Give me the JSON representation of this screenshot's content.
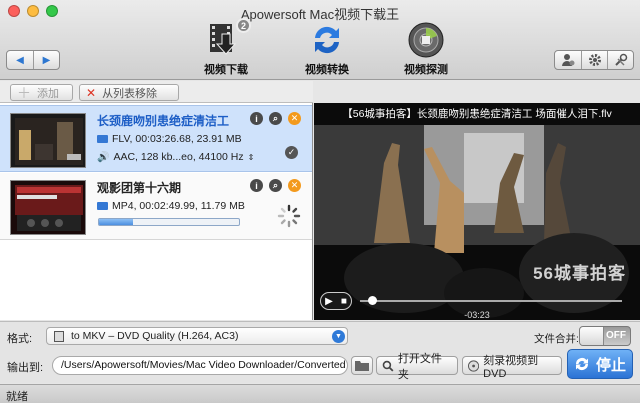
{
  "window": {
    "title": "Apowersoft Mac视频下载王"
  },
  "toolbar": {
    "back": "◀",
    "forward": "▶",
    "tools": [
      {
        "label": "视频下载",
        "badge": "2"
      },
      {
        "label": "视频转换"
      },
      {
        "label": "视频探测"
      }
    ]
  },
  "subbar": {
    "add_label": "添加",
    "remove_label": "从列表移除"
  },
  "items": [
    {
      "title": "长颈鹿吻别患绝症清洁工",
      "format_line": "FLV, 00:03:26.68, 23.91 MB",
      "audio_line": "AAC, 128 kb...eo, 44100 Hz",
      "status": "done"
    },
    {
      "title": "观影团第十六期",
      "format_line": "MP4, 00:02:49.99, 11.79 MB",
      "progress": 0.24,
      "status": "converting"
    }
  ],
  "video": {
    "title": "【56城事拍客】长颈鹿吻别患绝症清洁工 场面催人泪下.flv",
    "time": "-03:23",
    "watermark": "56城事拍客",
    "seek_position": 0.03
  },
  "bottom": {
    "format_label": "格式:",
    "format_value": "to MKV – DVD Quality (H.264, AC3)",
    "merge_label": "文件合并:",
    "merge_state": "OFF",
    "output_label": "输出到:",
    "output_path": "/Users/Apowersoft/Movies/Mac Video Downloader/Converted",
    "open_folder": "打开文件夹",
    "burn_dvd": "刻录视频到DVD",
    "stop": "停止"
  },
  "status": {
    "text": "就绪"
  },
  "colors": {
    "accent": "#2b73d5",
    "selection": "#cfe2fb",
    "delete": "#f39a1d"
  }
}
